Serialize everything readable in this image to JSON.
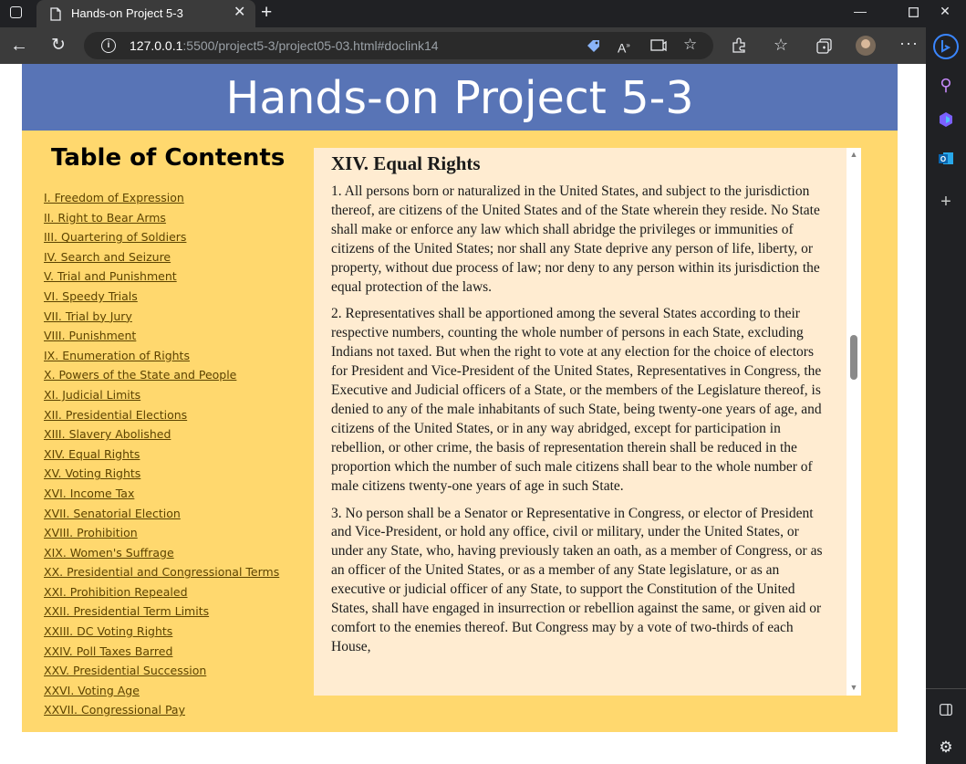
{
  "browser": {
    "tab_title": "Hands-on Project 5-3",
    "url_host": "127.0.0.1",
    "url_rest": ":5500/project5-3/project05-03.html#doclink14"
  },
  "page": {
    "header_title": "Hands-on Project 5-3",
    "toc_title": "Table of Contents",
    "toc_items": [
      "I. Freedom of Expression",
      "II. Right to Bear Arms",
      "III. Quartering of Soldiers",
      "IV. Search and Seizure",
      "V. Trial and Punishment",
      "VI. Speedy Trials",
      "VII. Trial by Jury",
      "VIII. Punishment",
      "IX. Enumeration of Rights",
      "X. Powers of the State and People",
      "XI. Judicial Limits",
      "XII. Presidential Elections",
      "XIII. Slavery Abolished",
      "XIV. Equal Rights",
      "XV. Voting Rights",
      "XVI. Income Tax",
      "XVII. Senatorial Election",
      "XVIII. Prohibition",
      "XIX. Women's Suffrage",
      "XX. Presidential and Congressional Terms",
      "XXI. Prohibition Repealed",
      "XXII. Presidential Term Limits",
      "XXIII. DC Voting Rights",
      "XXIV. Poll Taxes Barred",
      "XXV. Presidential Succession",
      "XXVI. Voting Age",
      "XXVII. Congressional Pay"
    ],
    "article": {
      "heading": "XIV. Equal Rights",
      "paragraphs": [
        "1. All persons born or naturalized in the United States, and subject to the jurisdiction thereof, are citizens of the United States and of the State wherein they reside. No State shall make or enforce any law which shall abridge the privileges or immunities of citizens of the United States; nor shall any State deprive any person of life, liberty, or property, without due process of law; nor deny to any person within its jurisdiction the equal protection of the laws.",
        "2. Representatives shall be apportioned among the several States according to their respective numbers, counting the whole number of persons in each State, excluding Indians not taxed. But when the right to vote at any election for the choice of electors for President and Vice-President of the United States, Representatives in Congress, the Executive and Judicial officers of a State, or the members of the Legislature thereof, is denied to any of the male inhabitants of such State, being twenty-one years of age, and citizens of the United States, or in any way abridged, except for participation in rebellion, or other crime, the basis of representation therein shall be reduced in the proportion which the number of such male citizens shall bear to the whole number of male citizens twenty-one years of age in such State.",
        "3. No person shall be a Senator or Representative in Congress, or elector of President and Vice-President, or hold any office, civil or military, under the United States, or under any State, who, having previously taken an oath, as a member of Congress, or as an officer of the United States, or as a member of any State legislature, or as an executive or judicial officer of any State, to support the Constitution of the United States, shall have engaged in insurrection or rebellion against the same, or given aid or comfort to the enemies thereof. But Congress may by a vote of two-thirds of each House,"
      ]
    }
  },
  "colors": {
    "header_bg": "#5874b6",
    "body_bg": "#ffd86e",
    "article_bg": "#ffecd1",
    "toc_link": "#5c4300"
  },
  "icons": [
    "window-menu-icon",
    "page-icon",
    "close-icon",
    "plus-icon",
    "minimize-icon",
    "maximize-icon",
    "window-close-icon",
    "back-arrow-icon",
    "refresh-icon",
    "info-icon",
    "tag-icon",
    "read-aloud-icon",
    "immersive-reader-icon",
    "add-favorite-icon",
    "extensions-icon",
    "favorites-icon",
    "collections-icon",
    "avatar",
    "more-icon",
    "bing-icon",
    "search-icon",
    "copilot-icon",
    "outlook-icon",
    "add-icon",
    "sidebar-toggle-icon",
    "settings-gear-icon"
  ]
}
